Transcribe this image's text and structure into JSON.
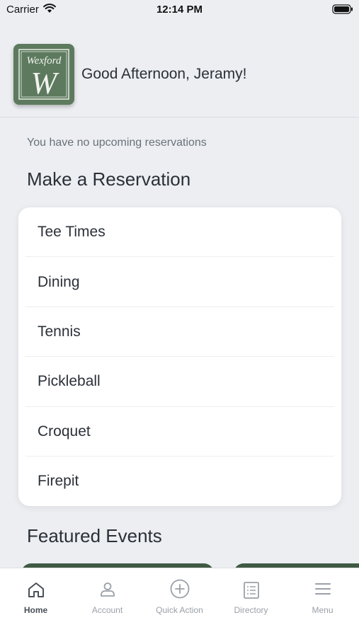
{
  "status_bar": {
    "carrier": "Carrier",
    "time": "12:14 PM"
  },
  "header": {
    "logo_text": "Wexford",
    "logo_letter": "W",
    "greeting": "Good Afternoon, Jeramy!"
  },
  "reservations": {
    "empty_message": "You have no upcoming reservations",
    "title": "Make a Reservation",
    "items": [
      {
        "label": "Tee Times"
      },
      {
        "label": "Dining"
      },
      {
        "label": "Tennis"
      },
      {
        "label": "Pickleball"
      },
      {
        "label": "Croquet"
      },
      {
        "label": "Firepit"
      }
    ]
  },
  "events": {
    "title": "Featured Events"
  },
  "tab_bar": {
    "tabs": [
      {
        "label": "Home",
        "icon": "home-icon",
        "active": true
      },
      {
        "label": "Account",
        "icon": "person-icon",
        "active": false
      },
      {
        "label": "Quick Action",
        "icon": "plus-circle-icon",
        "active": false
      },
      {
        "label": "Directory",
        "icon": "list-icon",
        "active": false
      },
      {
        "label": "Menu",
        "icon": "menu-icon",
        "active": false
      }
    ]
  },
  "colors": {
    "brand_green": "#5d7a5e",
    "background": "#eceef2",
    "tab_inactive": "#9aa0a8"
  }
}
